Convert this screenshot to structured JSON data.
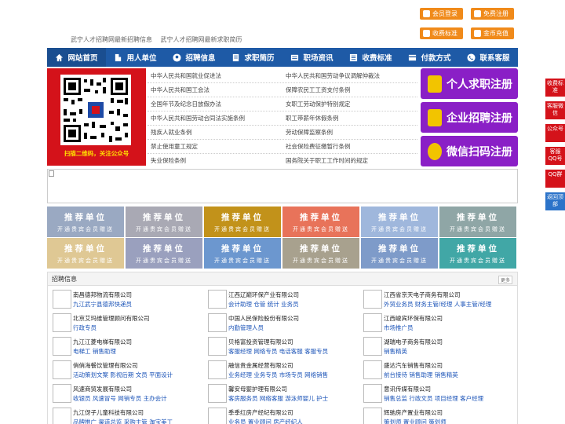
{
  "header": {
    "links": [
      "武宁人才招聘网最新招聘信息",
      "武宁人才招聘网最新求职简历"
    ],
    "buttons": [
      "会员登录",
      "免费注册",
      "收费标准",
      "金币充值"
    ]
  },
  "nav": [
    "网站首页",
    "用人单位",
    "招聘信息",
    "求职简历",
    "职场资讯",
    "收费标准",
    "付款方式",
    "联系客服"
  ],
  "qr": {
    "caption": "扫描二维码，关注公众号"
  },
  "laws": {
    "left": [
      "中华人民共和国就业促进法",
      "中华人民共和国工会法",
      "全国年节及纪念日放假办法",
      "中华人民共和国劳动合同法实施条例",
      "残疾人就业条例",
      "禁止使用童工规定",
      "失业保险条例"
    ],
    "right": [
      "中华人民共和国劳动争议调解仲裁法",
      "保障农民工工资支付条例",
      "女职工劳动保护特别规定",
      "职工带薪年休假条例",
      "劳动保障监察条例",
      "社会保险费征缴暂行条例",
      "国务院关于职工工作时间的规定"
    ]
  },
  "register": [
    "个人求职注册",
    "企业招聘注册",
    "微信扫码注册"
  ],
  "recommend": {
    "title": "推荐单位",
    "subtitle": "开通贵宾会员赠送"
  },
  "jobs": {
    "title": "招聘信息",
    "more": "更多",
    "items": [
      {
        "company": "南昌德邦物流有限公司",
        "positions": "九江武宁县德邦快递员"
      },
      {
        "company": "江西辽巅环保产业有限公司",
        "positions": "会计助理 仓管 统计 业务员"
      },
      {
        "company": "江西省京天电子商务有限公司",
        "positions": "外贸业务员 财务主管/经理 人事主管/经理"
      },
      {
        "company": "北京艾玛维管理顾问有限公司",
        "positions": "行政专员"
      },
      {
        "company": "中国人民保险股份有限公司",
        "positions": "内勤管理人员"
      },
      {
        "company": "江西峻宾环保有限公司",
        "positions": "市场推广员"
      },
      {
        "company": "九江江菱电梯有限公司",
        "positions": "电梯工 销售助理"
      },
      {
        "company": "贝格富投资管理有限公司",
        "positions": "客服经理 网络专员 电话客服 客服专员"
      },
      {
        "company": "湖瑞电子商务有限公司",
        "positions": "销售精英"
      },
      {
        "company": "俏俏海餐饮管理有限公司",
        "positions": "活动策划文案 影视后期 文员 平面设计"
      },
      {
        "company": "融信贵金属经营有限公司",
        "positions": "业务经理 业务专员 市场专员 网络销售"
      },
      {
        "company": "盛达汽车销售有限公司",
        "positions": "前台接待 销售助理 销售精英"
      },
      {
        "company": "风速商贸发展有限公司",
        "positions": "收银员 风速冒号 网销专员 主办会计"
      },
      {
        "company": "馨安母婴护理有限公司",
        "positions": "客房服务员 网络客服 游泳师婴儿 护士"
      },
      {
        "company": "意讯传媒有限公司",
        "positions": "销售总监 行政文员 项目经理 客户经理"
      },
      {
        "company": "九江伢子儿童科技有限公司",
        "positions": "品牌推广 渠道总监 采购主管 淘宝美工"
      },
      {
        "company": "季季红房产经纪有限公司",
        "positions": "业务员 置业顾问 房产经纪人"
      },
      {
        "company": "辉驰房产置业有限公司",
        "positions": "策划师 置业顾问 策划师"
      }
    ]
  },
  "side": [
    "收费标准",
    "客服微信",
    "公众号",
    "客服QQ号",
    "QQ群",
    "返回顶部"
  ],
  "colors": {
    "nav": "#1e5aa6",
    "accent_orange": "#f08a1a",
    "register_purple": "#8a1fc6",
    "side_red": "#d4121a",
    "link_blue": "#1d55b8",
    "recommend": [
      "#9aa9c2",
      "#a9a9b4",
      "#c2921a",
      "#e8735a",
      "#9fb7dc",
      "#8fa6a6",
      "#dfc894",
      "#9aa0be",
      "#6c97cf",
      "#a8a18e",
      "#7e9bc9",
      "#41a7a6"
    ]
  }
}
